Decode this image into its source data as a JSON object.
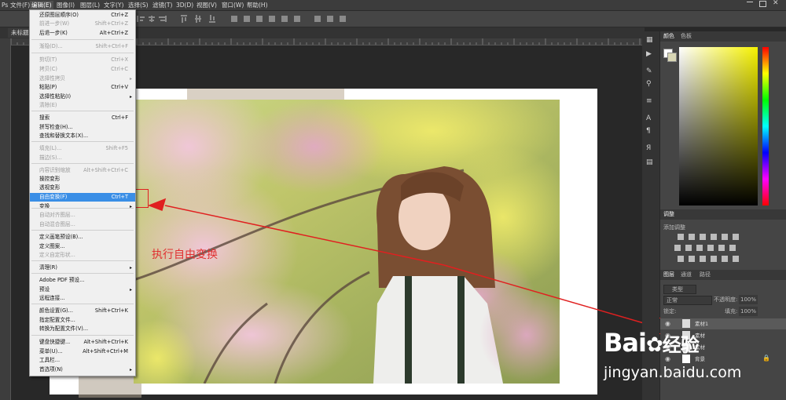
{
  "menubar": {
    "items": [
      "文件(F)",
      "编辑(E)",
      "图像(I)",
      "图层(L)",
      "文字(Y)",
      "选择(S)",
      "滤镜(T)",
      "3D(D)",
      "视图(V)",
      "窗口(W)",
      "帮助(H)"
    ],
    "active": "编辑(E)"
  },
  "document": {
    "tab_title": "未标题"
  },
  "edit_menu": {
    "items": [
      {
        "label": "还原图层顺序(O)",
        "shortcut": "Ctrl+Z",
        "state": "normal"
      },
      {
        "label": "前进一步(W)",
        "shortcut": "Shift+Ctrl+Z",
        "state": "disabled"
      },
      {
        "label": "后退一步(K)",
        "shortcut": "Alt+Ctrl+Z",
        "state": "normal"
      },
      {
        "label": "渐隐(D)...",
        "shortcut": "Shift+Ctrl+F",
        "state": "disabled"
      },
      {
        "label": "剪切(T)",
        "shortcut": "Ctrl+X",
        "state": "disabled"
      },
      {
        "label": "拷贝(C)",
        "shortcut": "Ctrl+C",
        "state": "disabled"
      },
      {
        "label": "选择性拷贝",
        "shortcut": "",
        "state": "disabled",
        "submenu": true
      },
      {
        "label": "粘贴(P)",
        "shortcut": "Ctrl+V",
        "state": "normal"
      },
      {
        "label": "选择性粘贴(I)",
        "shortcut": "",
        "state": "normal",
        "submenu": true
      },
      {
        "label": "清除(E)",
        "shortcut": "",
        "state": "disabled"
      },
      {
        "label": "搜索",
        "shortcut": "Ctrl+F",
        "state": "normal"
      },
      {
        "label": "拼写检查(H)...",
        "shortcut": "",
        "state": "normal"
      },
      {
        "label": "查找和替换文本(X)...",
        "shortcut": "",
        "state": "normal"
      },
      {
        "label": "填充(L)...",
        "shortcut": "Shift+F5",
        "state": "disabled"
      },
      {
        "label": "描边(S)...",
        "shortcut": "",
        "state": "disabled"
      },
      {
        "label": "内容识别缩放",
        "shortcut": "Alt+Shift+Ctrl+C",
        "state": "disabled"
      },
      {
        "label": "操控变形",
        "shortcut": "",
        "state": "normal"
      },
      {
        "label": "透视变形",
        "shortcut": "",
        "state": "normal"
      },
      {
        "label": "自由变换(F)",
        "shortcut": "Ctrl+T",
        "state": "highlighted"
      },
      {
        "label": "变换",
        "shortcut": "",
        "state": "normal",
        "submenu": true
      },
      {
        "label": "自动对齐图层...",
        "shortcut": "",
        "state": "disabled"
      },
      {
        "label": "自动混合图层...",
        "shortcut": "",
        "state": "disabled"
      },
      {
        "label": "定义画笔预设(B)...",
        "shortcut": "",
        "state": "normal"
      },
      {
        "label": "定义图案...",
        "shortcut": "",
        "state": "normal"
      },
      {
        "label": "定义自定形状...",
        "shortcut": "",
        "state": "disabled"
      },
      {
        "label": "清理(R)",
        "shortcut": "",
        "state": "normal",
        "submenu": true
      },
      {
        "label": "Adobe PDF 预设...",
        "shortcut": "",
        "state": "normal"
      },
      {
        "label": "预设",
        "shortcut": "",
        "state": "normal",
        "submenu": true
      },
      {
        "label": "远程连接...",
        "shortcut": "",
        "state": "normal"
      },
      {
        "label": "颜色设置(G)...",
        "shortcut": "Shift+Ctrl+K",
        "state": "normal"
      },
      {
        "label": "指定配置文件...",
        "shortcut": "",
        "state": "normal"
      },
      {
        "label": "转换为配置文件(V)...",
        "shortcut": "",
        "state": "normal"
      },
      {
        "label": "键盘快捷键...",
        "shortcut": "Alt+Shift+Ctrl+K",
        "state": "normal"
      },
      {
        "label": "菜单(U)...",
        "shortcut": "Alt+Shift+Ctrl+M",
        "state": "normal"
      },
      {
        "label": "工具栏...",
        "shortcut": "",
        "state": "normal"
      },
      {
        "label": "首选项(N)",
        "shortcut": "",
        "state": "normal",
        "submenu": true
      }
    ]
  },
  "annotation": {
    "text": "执行自由变换",
    "color": "#e03030"
  },
  "panels": {
    "color_tabs": [
      "颜色",
      "色板"
    ],
    "adjust_title": "调整",
    "adjust_hint": "添加调整",
    "layer_tabs": [
      "图层",
      "通道",
      "路径"
    ],
    "filter_kind": "类型",
    "blend_mode": "正常",
    "opacity_label": "不透明度:",
    "opacity_value": "100%",
    "lock_label": "锁定:",
    "fill_label": "填充:",
    "fill_value": "100%",
    "layers": [
      {
        "name": "素材1",
        "selected": true
      },
      {
        "name": "素材",
        "selected": false
      },
      {
        "name": "素材",
        "selected": false
      },
      {
        "name": "背景",
        "selected": false
      }
    ]
  },
  "watermark": {
    "brand": "Bai",
    "brand2": "经验",
    "url": "jingyan.baidu.com"
  },
  "colors": {
    "highlight": "#3a8ee6",
    "annotation_red": "#e02020",
    "menu_bg": "#f0f0f0"
  }
}
